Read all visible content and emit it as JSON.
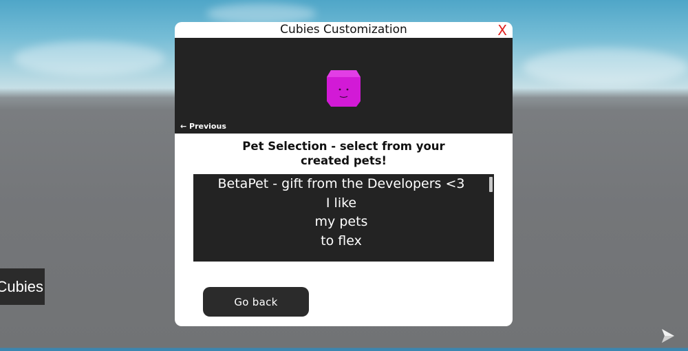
{
  "hud": {
    "side_button_label": "Cubies",
    "corner_logo_icon": "roblox-logo-icon"
  },
  "modal": {
    "title": "Cubies Customization",
    "close_label": "X",
    "close_color": "#e0201e",
    "preview": {
      "pet_icon": "magenta-cube-pet-icon",
      "pet_color": "#d21ad6",
      "previous_label": "← Previous"
    },
    "selection_heading": "Pet Selection - select from your created pets!",
    "pet_list": {
      "items": [
        "BetaPet - gift from the Developers <3",
        "I like",
        "my pets",
        "to flex"
      ]
    },
    "go_back_label": "Go back"
  }
}
